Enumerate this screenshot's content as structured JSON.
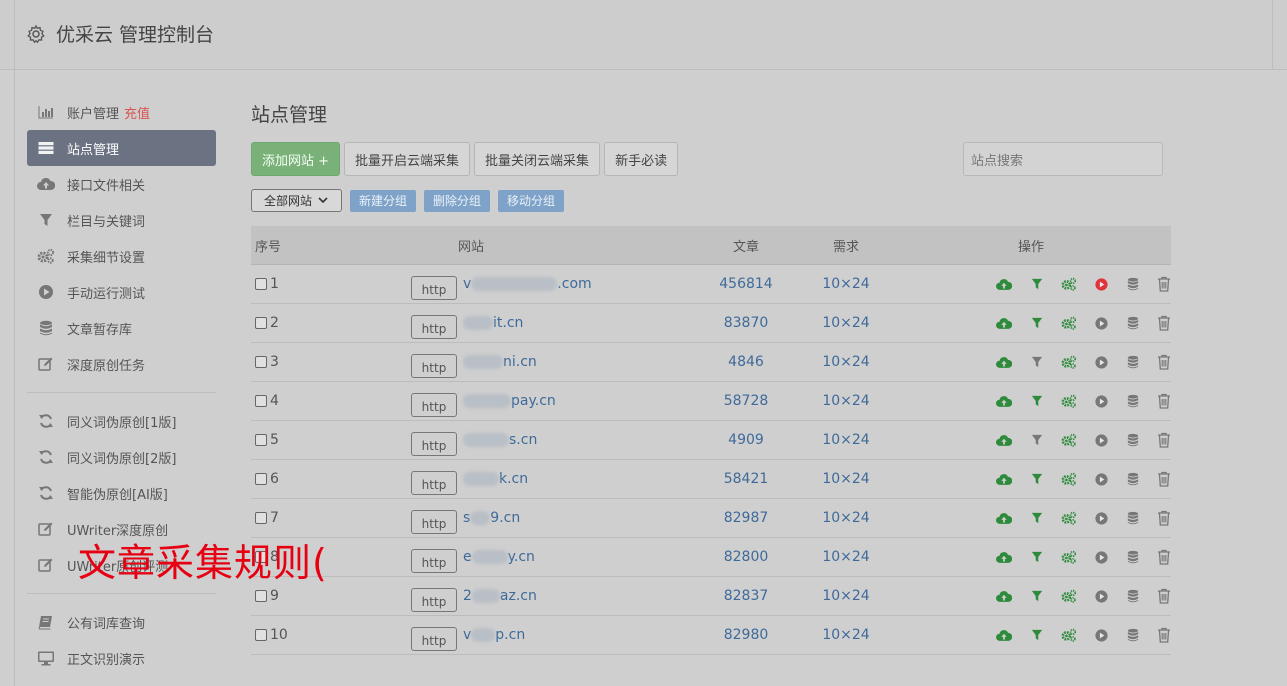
{
  "header": {
    "title": "优采云 管理控制台",
    "icon": "gear-icon"
  },
  "sidebar": {
    "groups": [
      [
        {
          "label": "账户管理",
          "badge": "充值",
          "icon": "bar-chart-icon"
        },
        {
          "label": "站点管理",
          "icon": "server-icon",
          "active": true
        },
        {
          "label": "接口文件相关",
          "icon": "cloud-upload-icon"
        },
        {
          "label": "栏目与关键词",
          "icon": "filter-icon"
        },
        {
          "label": "采集细节设置",
          "icon": "cogs-icon"
        },
        {
          "label": "手动运行测试",
          "icon": "play-circle-icon"
        },
        {
          "label": "文章暂存库",
          "icon": "database-icon"
        },
        {
          "label": "深度原创任务",
          "icon": "edit-icon"
        }
      ],
      [
        {
          "label": "同义词伪原创[1版]",
          "icon": "refresh-icon"
        },
        {
          "label": "同义词伪原创[2版]",
          "icon": "refresh-icon"
        },
        {
          "label": "智能伪原创[AI版]",
          "icon": "refresh-icon"
        },
        {
          "label": "UWriter深度原创",
          "icon": "edit-icon"
        },
        {
          "label": "UWriter原创评测",
          "icon": "edit-icon"
        }
      ],
      [
        {
          "label": "公有词库查询",
          "icon": "book-icon"
        },
        {
          "label": "正文识别演示",
          "icon": "monitor-icon"
        }
      ]
    ]
  },
  "main": {
    "title": "站点管理",
    "toolbar": {
      "add_site": "添加网站 +",
      "batch_open": "批量开启云端采集",
      "batch_close": "批量关闭云端采集",
      "guide": "新手必读"
    },
    "search_placeholder": "站点搜索",
    "group_select": "全部网站",
    "group_buttons": {
      "new": "新建分组",
      "delete": "删除分组",
      "move": "移动分组"
    },
    "table": {
      "headers": {
        "no": "序号",
        "site": "网站",
        "articles": "文章",
        "demand": "需求",
        "ops": "操作"
      },
      "rows": [
        {
          "no": "1",
          "http": "http",
          "pre": "v",
          "suffix": ".com",
          "articles": "456814",
          "demand": "10×24",
          "filter_active": true,
          "play_red": true
        },
        {
          "no": "2",
          "http": "http",
          "pre": "",
          "suffix": "it.cn",
          "articles": "83870",
          "demand": "10×24",
          "filter_active": true,
          "play_red": false
        },
        {
          "no": "3",
          "http": "http",
          "pre": "",
          "suffix": "ni.cn",
          "articles": "4846",
          "demand": "10×24",
          "filter_active": false,
          "play_red": false
        },
        {
          "no": "4",
          "http": "http",
          "pre": "",
          "suffix": "pay.cn",
          "articles": "58728",
          "demand": "10×24",
          "filter_active": true,
          "play_red": false
        },
        {
          "no": "5",
          "http": "http",
          "pre": "",
          "suffix": "s.cn",
          "articles": "4909",
          "demand": "10×24",
          "filter_active": false,
          "play_red": false
        },
        {
          "no": "6",
          "http": "http",
          "pre": "",
          "suffix": "k.cn",
          "articles": "58421",
          "demand": "10×24",
          "filter_active": true,
          "play_red": false
        },
        {
          "no": "7",
          "http": "http",
          "pre": "s",
          "suffix": "9.cn",
          "articles": "82987",
          "demand": "10×24",
          "filter_active": true,
          "play_red": false
        },
        {
          "no": "8",
          "http": "http",
          "pre": "e",
          "suffix": "y.cn",
          "articles": "82800",
          "demand": "10×24",
          "filter_active": true,
          "play_red": false
        },
        {
          "no": "9",
          "http": "http",
          "pre": "2",
          "suffix": "az.cn",
          "articles": "82837",
          "demand": "10×24",
          "filter_active": true,
          "play_red": false
        },
        {
          "no": "10",
          "http": "http",
          "pre": "v",
          "suffix": "p.cn",
          "articles": "82980",
          "demand": "10×24",
          "filter_active": true,
          "play_red": false
        }
      ]
    }
  },
  "overlay_text": "文章采集规则(",
  "colors": {
    "green": "#2e8b3c",
    "red": "#e0343a",
    "gray_icon": "#777777",
    "link": "#3e6a9a"
  }
}
